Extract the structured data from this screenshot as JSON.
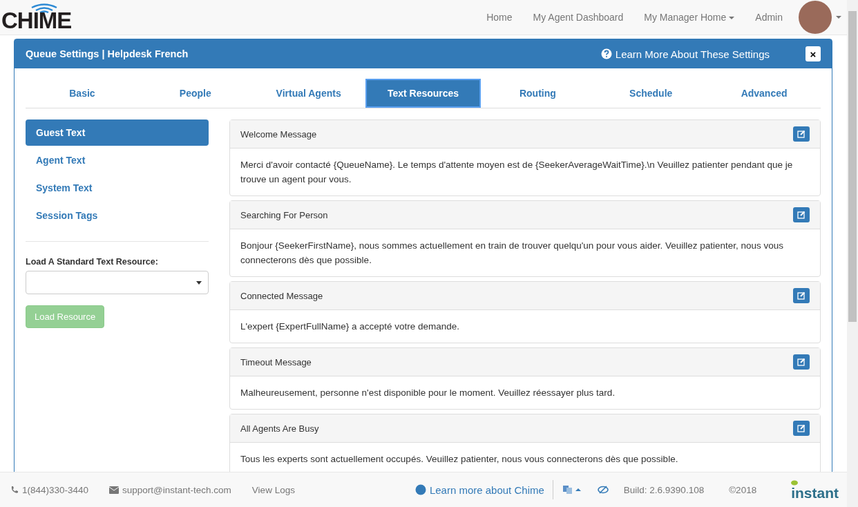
{
  "brand": {
    "logo": "CHIME"
  },
  "nav": [
    {
      "label": "Home",
      "dropdown": false
    },
    {
      "label": "My Agent Dashboard",
      "dropdown": false
    },
    {
      "label": "My Manager Home",
      "dropdown": true
    },
    {
      "label": "Admin",
      "dropdown": false
    }
  ],
  "modal": {
    "title": "Queue Settings | Helpdesk French",
    "help_link": "Learn More About These Settings",
    "close": "×"
  },
  "tabs": [
    {
      "label": "Basic",
      "selected": false
    },
    {
      "label": "People",
      "selected": false
    },
    {
      "label": "Virtual Agents",
      "selected": false
    },
    {
      "label": "Text Resources",
      "selected": true
    },
    {
      "label": "Routing",
      "selected": false
    },
    {
      "label": "Schedule",
      "selected": false
    },
    {
      "label": "Advanced",
      "selected": false
    }
  ],
  "sidebar": {
    "items": [
      {
        "label": "Guest Text",
        "selected": true
      },
      {
        "label": "Agent Text",
        "selected": false
      },
      {
        "label": "System Text",
        "selected": false
      },
      {
        "label": "Session Tags",
        "selected": false
      }
    ],
    "standard_label": "Load A Standard Text Resource:",
    "load_button": {
      "label": "Load Resource",
      "disabled": true
    }
  },
  "resources": [
    {
      "title": "Welcome Message",
      "text": "Merci d'avoir contacté {QueueName}. Le temps d'attente moyen est de {SeekerAverageWaitTime}.\\n Veuillez patienter pendant que je trouve un agent pour vous."
    },
    {
      "title": "Searching For Person",
      "text": "Bonjour {SeekerFirstName}, nous sommes actuellement en train de trouver quelqu'un pour vous aider. Veuillez patienter, nous vous connecterons dès que possible."
    },
    {
      "title": "Connected Message",
      "text": "L'expert {ExpertFullName} a accepté votre demande."
    },
    {
      "title": "Timeout Message",
      "text": "Malheureusement, personne n'est disponible pour le moment. Veuillez réessayer plus tard."
    },
    {
      "title": "All Agents Are Busy",
      "text": "Tous les experts sont actuellement occupés. Veuillez patienter, nous vous connecterons dès que possible."
    }
  ],
  "footer": {
    "phone": "1(844)330-3440",
    "email": "support@instant-tech.com",
    "view_logs": "View Logs",
    "learn_more": "Learn more about Chime",
    "build": "Build: 2.6.9390.108",
    "copyright": "©2018",
    "company_logo": "instant"
  }
}
